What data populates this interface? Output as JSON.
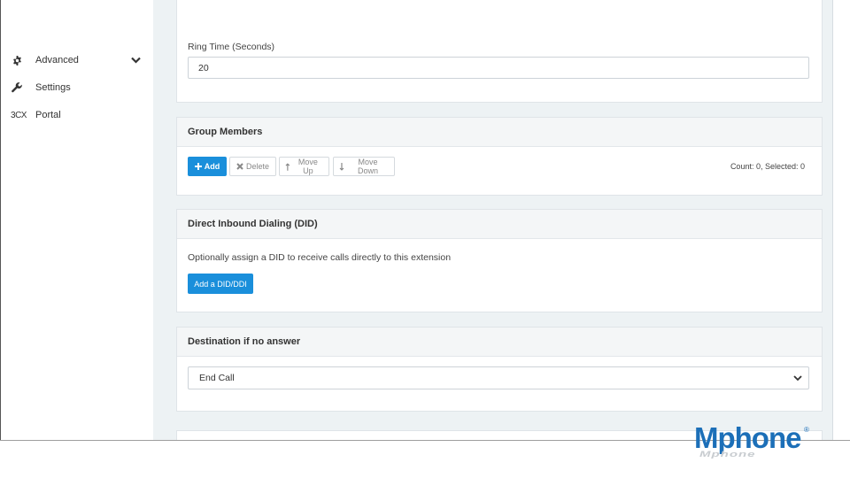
{
  "sidebar": {
    "items": [
      {
        "label": "Advanced",
        "icon": "gear-icon",
        "has_chevron": true
      },
      {
        "label": "Settings",
        "icon": "wrench-icon"
      },
      {
        "label": "Portal",
        "icon_text": "3CX"
      }
    ]
  },
  "ring_time": {
    "label": "Ring Time (Seconds)",
    "value": "20"
  },
  "group_members": {
    "title": "Group Members",
    "add_label": "Add",
    "delete_label": "Delete",
    "move_up_label": "Move Up",
    "move_down_label": "Move Down",
    "count_text": "Count: 0, Selected: 0"
  },
  "did": {
    "title": "Direct Inbound Dialing (DID)",
    "description": "Optionally assign a DID to receive calls directly to this extension",
    "button_label": "Add a DID/DDI"
  },
  "destination": {
    "title": "Destination if no answer",
    "selected": "End Call"
  },
  "logo": {
    "text": "Mphone",
    "reflection": "Mphone",
    "registered": "®"
  },
  "colors": {
    "primary": "#1a8fdb",
    "logo": "#1c6fb8"
  }
}
